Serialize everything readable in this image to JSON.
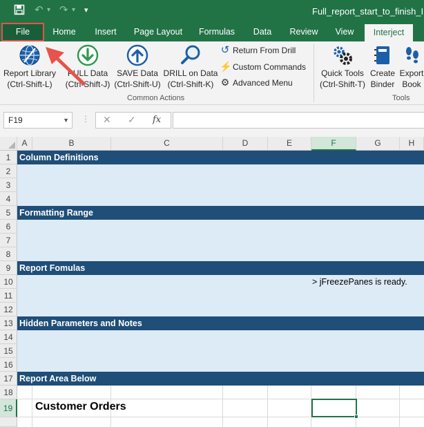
{
  "window": {
    "title": "Full_report_start_to_finish_IN_P"
  },
  "quick_access": {
    "icons": [
      "save-icon",
      "undo-icon",
      "redo-icon",
      "customize-icon"
    ]
  },
  "tabs": [
    {
      "label": "File",
      "state": "highlighted"
    },
    {
      "label": "Home"
    },
    {
      "label": "Insert"
    },
    {
      "label": "Page Layout"
    },
    {
      "label": "Formulas"
    },
    {
      "label": "Data"
    },
    {
      "label": "Review"
    },
    {
      "label": "View"
    },
    {
      "label": "Interject",
      "state": "active"
    }
  ],
  "ribbon": {
    "report_library": {
      "label": "Report Library",
      "shortcut": "(Ctrl-Shift-L)"
    },
    "pull_data": {
      "label": "PULL Data",
      "shortcut": "(Ctrl-Shift-J)"
    },
    "save_data": {
      "label": "SAVE Data",
      "shortcut": "(Ctrl-Shift-U)"
    },
    "drill_on_data": {
      "label": "DRILL on Data",
      "shortcut": "(Ctrl-Shift-K)"
    },
    "return_from_drill": "Return From Drill",
    "custom_commands": "Custom Commands",
    "advanced_menu": "Advanced Menu",
    "common_actions_label": "Common Actions",
    "quick_tools": {
      "label": "Quick Tools",
      "shortcut": "(Ctrl-Shift-T)"
    },
    "create_binder": {
      "label": "Create",
      "label2": "Binder"
    },
    "export_book": {
      "label": "Export",
      "label2": "Book"
    },
    "tools_label": "Tools",
    "accent_color": "#217346"
  },
  "formula_bar": {
    "name_box": "F19",
    "cancel_symbol": "✕",
    "enter_symbol": "✓",
    "fx_symbol": "fx",
    "formula": ""
  },
  "grid": {
    "columns": [
      "A",
      "B",
      "C",
      "D",
      "E",
      "F",
      "G",
      "H"
    ],
    "selected_column": "F",
    "rows": [
      "1",
      "2",
      "3",
      "4",
      "5",
      "6",
      "7",
      "8",
      "9",
      "10",
      "11",
      "12",
      "13",
      "14",
      "15",
      "16",
      "17",
      "18",
      "19"
    ],
    "selected_row": "19",
    "section_headers": {
      "r1": "Column Definitions",
      "r5": "Formatting Range",
      "r9": "Report Fomulas",
      "r13": "Hidden Parameters and Notes",
      "r17": "Report Area Below"
    },
    "status_message": "> jFreezePanes is ready.",
    "report_title": "Customer Orders",
    "section_fill": "#1f4e78",
    "light_fill": "#ddebf7"
  }
}
